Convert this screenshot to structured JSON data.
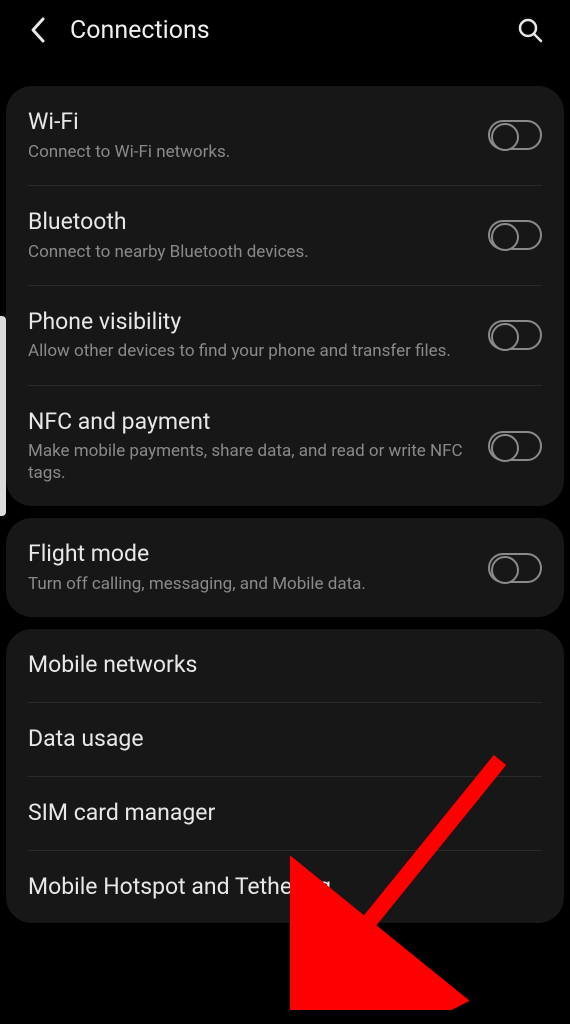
{
  "header": {
    "title": "Connections"
  },
  "groups": [
    {
      "items": [
        {
          "id": "wifi",
          "title": "Wi-Fi",
          "sub": "Connect to Wi-Fi networks.",
          "toggle": true
        },
        {
          "id": "bluetooth",
          "title": "Bluetooth",
          "sub": "Connect to nearby Bluetooth devices.",
          "toggle": true
        },
        {
          "id": "phone-visibility",
          "title": "Phone visibility",
          "sub": "Allow other devices to find your phone and transfer files.",
          "toggle": true
        },
        {
          "id": "nfc-payment",
          "title": "NFC and payment",
          "sub": "Make mobile payments, share data, and read or write NFC tags.",
          "toggle": true
        }
      ]
    },
    {
      "items": [
        {
          "id": "flight-mode",
          "title": "Flight mode",
          "sub": "Turn off calling, messaging, and Mobile data.",
          "toggle": true
        }
      ]
    },
    {
      "items": [
        {
          "id": "mobile-networks",
          "title": "Mobile networks",
          "sub": "",
          "toggle": false
        },
        {
          "id": "data-usage",
          "title": "Data usage",
          "sub": "",
          "toggle": false
        },
        {
          "id": "sim-card-manager",
          "title": "SIM card manager",
          "sub": "",
          "toggle": false
        },
        {
          "id": "mobile-hotspot",
          "title": "Mobile Hotspot and Tethering",
          "sub": "",
          "toggle": false
        }
      ]
    }
  ],
  "annotation": {
    "arrow_color": "#ff0000"
  }
}
